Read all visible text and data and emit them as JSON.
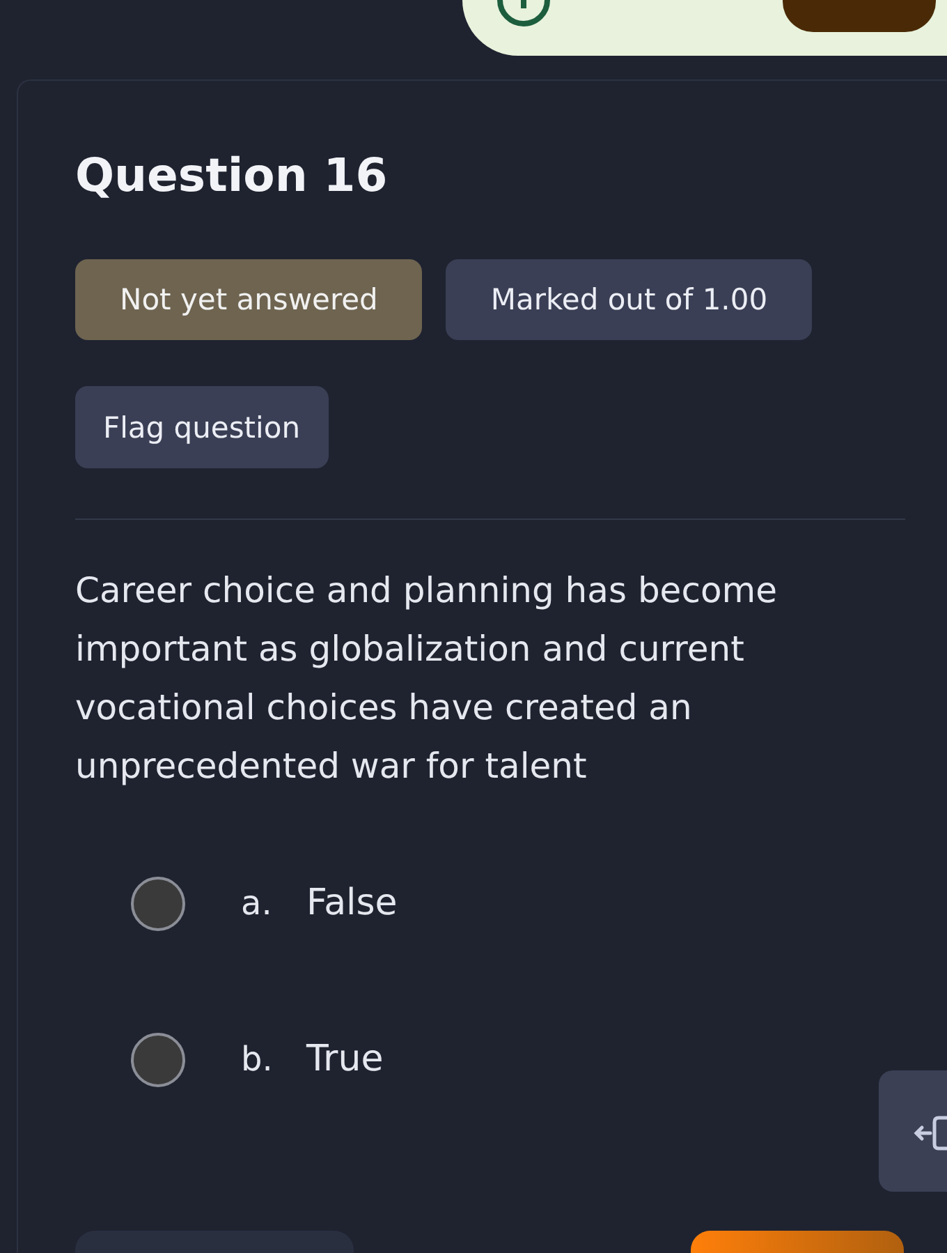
{
  "question": {
    "title": "Question 16",
    "status": "Not yet answered",
    "mark": "Marked out of 1.00",
    "flag": "Flag question",
    "text": "Career choice and planning has become important as globalization and current vocational choices have created an unprecedented war for talent"
  },
  "options": [
    {
      "letter": "a.",
      "label": "False",
      "selected": false
    },
    {
      "letter": "b.",
      "label": "True",
      "selected": false
    }
  ]
}
